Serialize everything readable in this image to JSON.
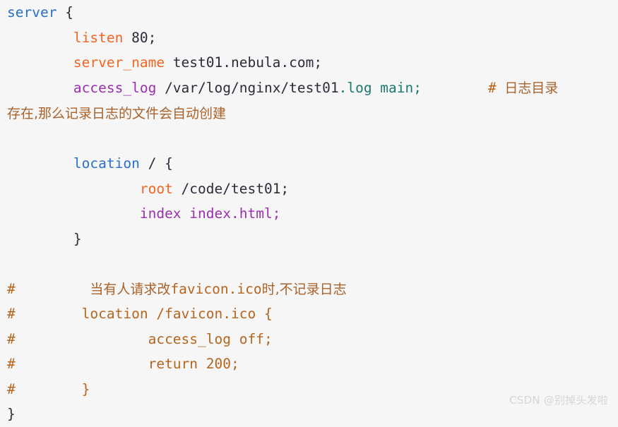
{
  "background_color": "#f6f6f6",
  "palette": {
    "directive": "#2a6fc9",
    "keyword": "#f26522",
    "builtin": "#9b2fae",
    "literal": "#1a7a6e",
    "plain": "#2b2b3a",
    "comment": "#b5651d",
    "comment_cn": "#a9622a",
    "watermark": "#d6d6d6"
  },
  "code": {
    "language": "nginx",
    "lines": [
      {
        "id": "line-1",
        "text": "server {",
        "tokens": [
          {
            "t": "server",
            "role": "directive"
          },
          {
            "t": " {",
            "role": "plain"
          }
        ]
      },
      {
        "id": "line-2",
        "text": "        listen 80;",
        "tokens": [
          {
            "t": "        ",
            "role": "plain"
          },
          {
            "t": "listen",
            "role": "keyword"
          },
          {
            "t": " 80;",
            "role": "plain"
          }
        ]
      },
      {
        "id": "line-3",
        "text": "        server_name test01.nebula.com;",
        "tokens": [
          {
            "t": "        ",
            "role": "plain"
          },
          {
            "t": "server_name",
            "role": "keyword"
          },
          {
            "t": " test01.nebula.com;",
            "role": "plain"
          }
        ]
      },
      {
        "id": "line-4",
        "text": "        access_log /var/log/nginx/test01.log main;        # 日志目录",
        "tokens": [
          {
            "t": "        ",
            "role": "plain"
          },
          {
            "t": "access_log",
            "role": "builtin"
          },
          {
            "t": " /var/log/nginx/test01",
            "role": "plain"
          },
          {
            "t": ".log main;",
            "role": "literal"
          },
          {
            "t": "        ",
            "role": "plain"
          },
          {
            "t": "# ",
            "role": "comment"
          },
          {
            "t": "日志目录",
            "role": "comment_cn"
          }
        ]
      },
      {
        "id": "line-5",
        "text": "存在,那么记录日志的文件会自动创建",
        "tokens": [
          {
            "t": "存在,那么记录日志的文件会自动创建",
            "role": "comment_cn"
          }
        ]
      },
      {
        "id": "line-6",
        "text": "",
        "tokens": []
      },
      {
        "id": "line-7",
        "text": "        location / {",
        "tokens": [
          {
            "t": "        ",
            "role": "plain"
          },
          {
            "t": "location",
            "role": "directive"
          },
          {
            "t": " / {",
            "role": "plain"
          }
        ]
      },
      {
        "id": "line-8",
        "text": "                root /code/test01;",
        "tokens": [
          {
            "t": "                ",
            "role": "plain"
          },
          {
            "t": "root",
            "role": "keyword"
          },
          {
            "t": " /code/test01;",
            "role": "plain"
          }
        ]
      },
      {
        "id": "line-9",
        "text": "                index index.html;",
        "tokens": [
          {
            "t": "                ",
            "role": "plain"
          },
          {
            "t": "index index.html;",
            "role": "builtin"
          }
        ]
      },
      {
        "id": "line-10",
        "text": "        }",
        "tokens": [
          {
            "t": "        }",
            "role": "plain"
          }
        ]
      },
      {
        "id": "line-11",
        "text": "",
        "tokens": []
      },
      {
        "id": "line-12",
        "text": "#         当有人请求改favicon.ico时,不记录日志",
        "tokens": [
          {
            "t": "#",
            "role": "comment"
          },
          {
            "t": "         ",
            "role": "comment"
          },
          {
            "t": "当有人请求改",
            "role": "comment_cn"
          },
          {
            "t": "favicon.ico",
            "role": "comment"
          },
          {
            "t": "时,不记录日志",
            "role": "comment_cn"
          }
        ]
      },
      {
        "id": "line-13",
        "text": "#        location /favicon.ico {",
        "tokens": [
          {
            "t": "#",
            "role": "comment"
          },
          {
            "t": "        location /favicon.ico {",
            "role": "comment"
          }
        ]
      },
      {
        "id": "line-14",
        "text": "#                access_log off;",
        "tokens": [
          {
            "t": "#",
            "role": "comment"
          },
          {
            "t": "                access_log off;",
            "role": "comment"
          }
        ]
      },
      {
        "id": "line-15",
        "text": "#                return 200;",
        "tokens": [
          {
            "t": "#",
            "role": "comment"
          },
          {
            "t": "                return 200;",
            "role": "comment"
          }
        ]
      },
      {
        "id": "line-16",
        "text": "#        }",
        "tokens": [
          {
            "t": "#",
            "role": "comment"
          },
          {
            "t": "        }",
            "role": "comment"
          }
        ]
      },
      {
        "id": "line-17",
        "text": "}",
        "tokens": [
          {
            "t": "}",
            "role": "plain"
          }
        ]
      }
    ]
  },
  "watermark": {
    "text": "CSDN @别掉头发啦"
  }
}
